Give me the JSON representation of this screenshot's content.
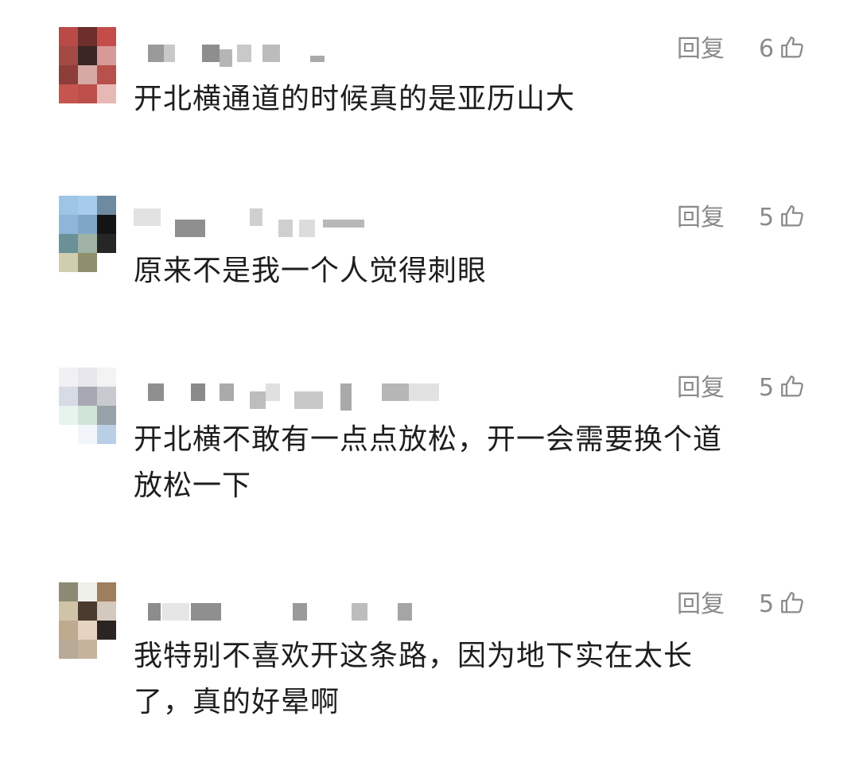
{
  "comments": [
    {
      "reply_label": "回复",
      "likes": "6",
      "text": "开北横通道的时候真的是亚历山大",
      "like_icon": "thumbs-up-icon"
    },
    {
      "reply_label": "回复",
      "likes": "5",
      "text": "原来不是我一个人觉得刺眼",
      "like_icon": "thumbs-up-icon"
    },
    {
      "reply_label": "回复",
      "likes": "5",
      "text": "开北横不敢有一点点放松，开一会需要换个道\n放松一下",
      "like_icon": "thumbs-up-icon"
    },
    {
      "reply_label": "回复",
      "likes": "5",
      "text": "我特别不喜欢开这条路，因为地下实在太长\n了，真的好晕啊",
      "like_icon": "thumbs-up-icon"
    }
  ],
  "colors": {
    "text": "#1e1e1e",
    "meta": "#8a8a8a",
    "background": "#ffffff"
  }
}
